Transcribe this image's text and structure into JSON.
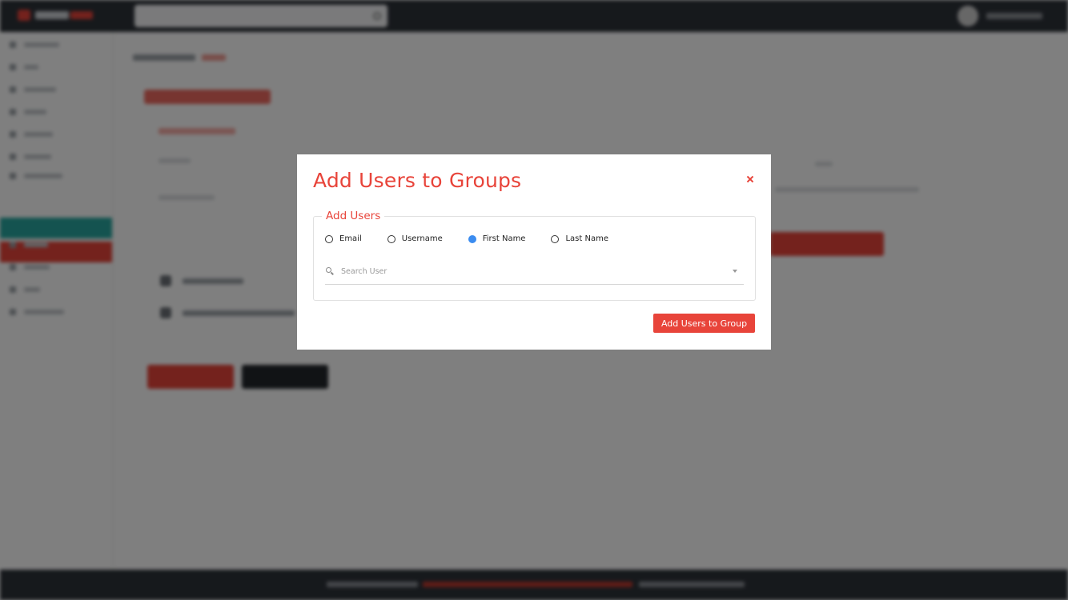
{
  "modal": {
    "title": "Add Users to Groups",
    "close_symbol": "×",
    "section_legend": "Add Users",
    "search_by_options": [
      {
        "label": "Email",
        "checked": false
      },
      {
        "label": "Username",
        "checked": false
      },
      {
        "label": "First Name",
        "checked": true
      },
      {
        "label": "Last Name",
        "checked": false
      }
    ],
    "search": {
      "placeholder": "Search User",
      "value": ""
    },
    "submit_label": "Add Users to Group"
  },
  "colors": {
    "accent": "#e8443a",
    "radio_checked": "#3b8cf0",
    "topbar": "#2d3239",
    "sidebar_active": "#28a7a0"
  },
  "icons": {
    "close": "close-icon",
    "search": "search-icon",
    "dropdown": "caret-down-icon"
  }
}
